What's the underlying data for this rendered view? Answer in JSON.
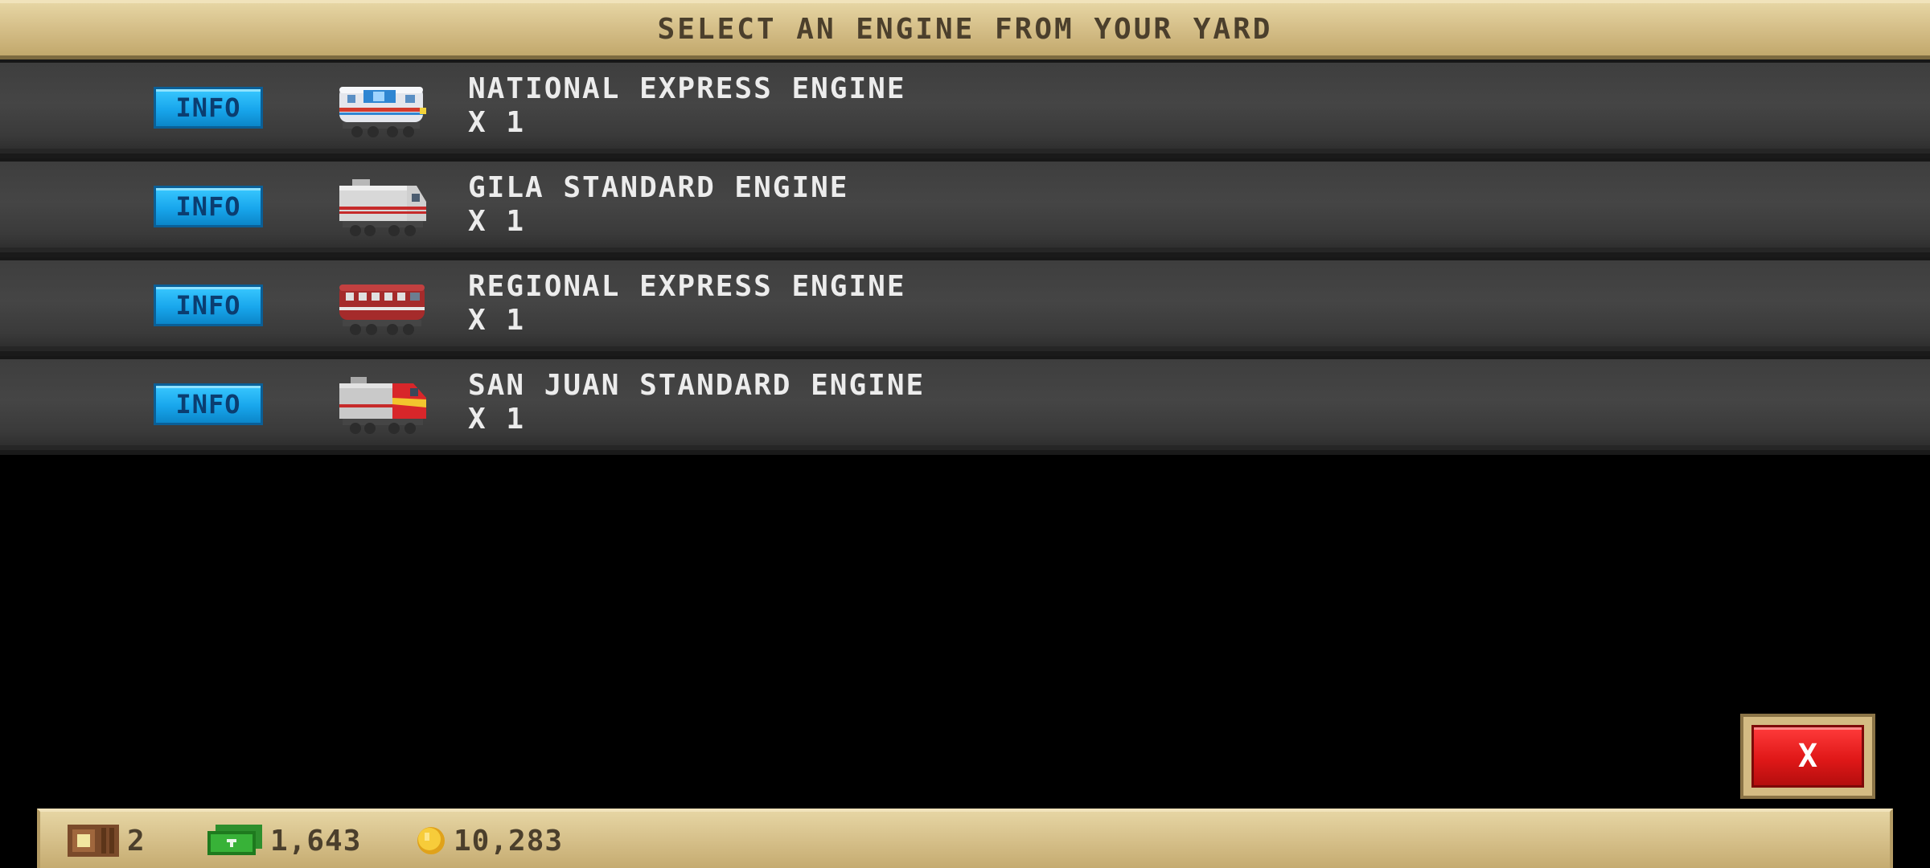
{
  "header": {
    "title": "SELECT AN ENGINE FROM YOUR YARD"
  },
  "engines": [
    {
      "info_label": "INFO",
      "name": "NATIONAL EXPRESS ENGINE",
      "count": "X 1",
      "icon": "national-express-engine-icon"
    },
    {
      "info_label": "INFO",
      "name": "GILA STANDARD ENGINE",
      "count": "X 1",
      "icon": "gila-standard-engine-icon"
    },
    {
      "info_label": "INFO",
      "name": "REGIONAL EXPRESS ENGINE",
      "count": "X 1",
      "icon": "regional-express-engine-icon"
    },
    {
      "info_label": "INFO",
      "name": "SAN JUAN STANDARD ENGINE",
      "count": "X 1",
      "icon": "san-juan-standard-engine-icon"
    }
  ],
  "close_button": {
    "label": "X"
  },
  "status_bar": {
    "boxes": {
      "value": "2",
      "icon": "crate-icon"
    },
    "cash": {
      "value": "1,643",
      "icon": "cash-icon"
    },
    "coins": {
      "value": "10,283",
      "icon": "coin-icon"
    }
  },
  "colors": {
    "info_button": "#18a6ec",
    "close_button": "#e01818",
    "panel": "#d6c08a",
    "row": "#3e3e3e"
  }
}
